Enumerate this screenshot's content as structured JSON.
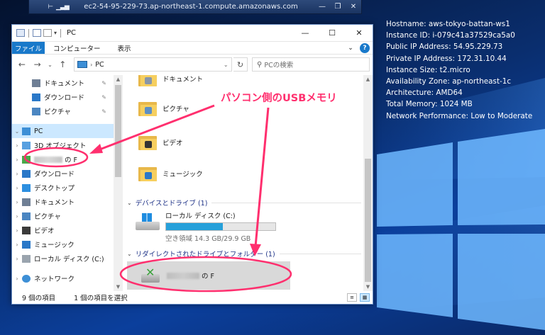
{
  "rdp": {
    "host": "ec2-54-95-229-73.ap-northeast-1.compute.amazonaws.com",
    "pin_icon": "pin-icon",
    "signal_icon": "signal-icon"
  },
  "sysinfo": [
    "Hostname: aws-tokyo-battan-ws1",
    "Instance ID: i-079c41a37529ca5a0",
    "Public IP Address: 54.95.229.73",
    "Private IP Address: 172.31.10.44",
    "Instance Size: t2.micro",
    "Availability Zone: ap-northeast-1c",
    "Architecture: AMD64",
    "Total Memory: 1024 MB",
    "Network Performance: Low to Moderate"
  ],
  "window": {
    "title": "PC",
    "minimize": "—",
    "maximize": "☐",
    "close": "✕"
  },
  "ribbon": {
    "file": "ファイル",
    "tabs": [
      "コンピューター",
      "表示"
    ],
    "help": "?"
  },
  "nav": {
    "address": "PC",
    "search_placeholder": "PCの検索"
  },
  "navpane": {
    "quick": [
      {
        "label": "ドキュメント",
        "color": "#6f7f95"
      },
      {
        "label": "ダウンロード",
        "color": "#2a78c8"
      },
      {
        "label": "ピクチャ",
        "color": "#4b86c2"
      }
    ],
    "pc_label": "PC",
    "pc_children": [
      {
        "label": "3D オブジェクト",
        "color": "#58a0e0"
      },
      {
        "label": "の F",
        "color": "#4aa84a",
        "blur": true
      },
      {
        "label": "ダウンロード",
        "color": "#2a78c8"
      },
      {
        "label": "デスクトップ",
        "color": "#2d8fe0"
      },
      {
        "label": "ドキュメント",
        "color": "#6f7f95"
      },
      {
        "label": "ピクチャ",
        "color": "#4b86c2"
      },
      {
        "label": "ビデオ",
        "color": "#3b3b3b"
      },
      {
        "label": "ミュージック",
        "color": "#2a78c8"
      },
      {
        "label": "ローカル ディスク (C:)",
        "color": "#9aa4ae"
      }
    ],
    "network_label": "ネットワーク"
  },
  "main": {
    "folders": [
      {
        "label": "ドキュメント",
        "badge": "#8896a8"
      },
      {
        "label": "ピクチャ",
        "badge": "#5d8fc4"
      },
      {
        "label": "ビデオ",
        "badge": "#333333"
      },
      {
        "label": "ミュージック",
        "badge": "#2a78c8"
      }
    ],
    "devices_header": "デバイスとドライブ (1)",
    "drive": {
      "name": "ローカル ディスク (C:)",
      "free": "空き領域 14.3 GB/29.9 GB",
      "used_fraction": 0.52
    },
    "redirect_header": "リダイレクトされたドライブとフォルダー (1)",
    "net_drive_label": "の F"
  },
  "status": {
    "count": "9 個の項目",
    "selected": "1 個の項目を選択"
  },
  "annotation": {
    "text": "パソコン側のUSBメモリ",
    "color": "#ff2f6e"
  }
}
